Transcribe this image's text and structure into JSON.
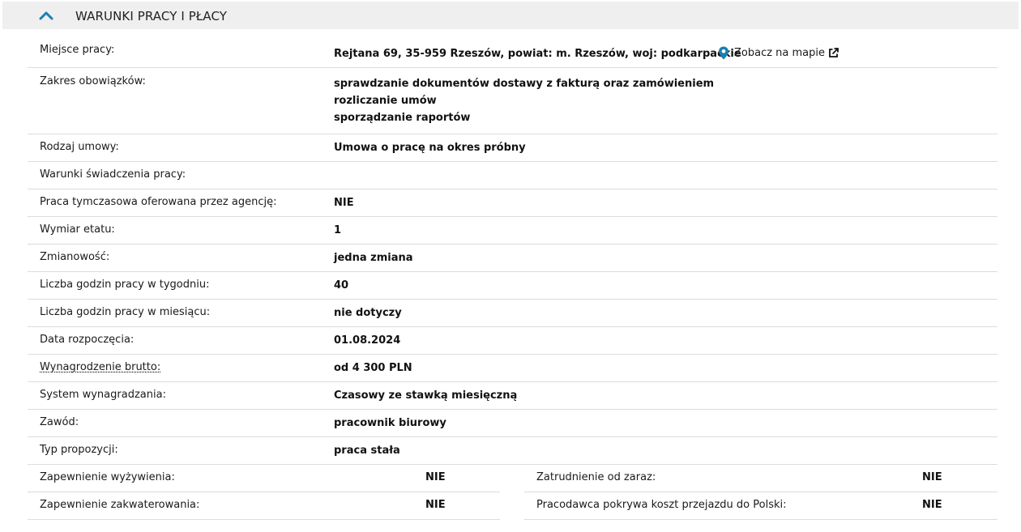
{
  "section": {
    "title": "WARUNKI PRACY I PŁACY",
    "accent_color": "#1a7fb5"
  },
  "location": {
    "label": "Miejsce pracy:",
    "value": "Rejtana 69, 35-959 Rzeszów, powiat: m. Rzeszów, woj: podkarpackie",
    "map_link": "Zobacz na mapie",
    "map_icon": "map-pin-icon",
    "external_icon": "external-link-icon"
  },
  "duties": {
    "label": "Zakres obowiązków:",
    "items": [
      "sprawdzanie dokumentów dostawy z fakturą oraz zamówieniem",
      "rozliczanie umów",
      "sporządzanie raportów"
    ]
  },
  "rows": [
    {
      "label": "Rodzaj umowy:",
      "value": "Umowa o pracę na okres próbny"
    },
    {
      "label": "Warunki świadczenia pracy:",
      "value": ""
    },
    {
      "label": "Praca tymczasowa oferowana przez agencję:",
      "value": "NIE"
    },
    {
      "label": "Wymiar etatu:",
      "value": "1"
    },
    {
      "label": "Zmianowość:",
      "value": "jedna zmiana"
    },
    {
      "label": "Liczba godzin pracy w tygodniu:",
      "value": "40"
    },
    {
      "label": "Liczba godzin pracy w miesiącu:",
      "value": "nie dotyczy"
    },
    {
      "label": "Data rozpoczęcia:",
      "value": "01.08.2024"
    },
    {
      "label": "Wynagrodzenie brutto:",
      "value": "od 4 300 PLN"
    },
    {
      "label": "System wynagradzania:",
      "value": "Czasowy ze stawką miesięczną"
    },
    {
      "label": "Zawód:",
      "value": "pracownik biurowy"
    },
    {
      "label": "Typ propozycji:",
      "value": "praca stała"
    }
  ],
  "pairs": [
    {
      "left": {
        "label": "Zapewnienie wyżywienia:",
        "value": "NIE"
      },
      "right": {
        "label": "Zatrudnienie od zaraz:",
        "value": "NIE"
      }
    },
    {
      "left": {
        "label": "Zapewnienie zakwaterowania:",
        "value": "NIE"
      },
      "right": {
        "label": "Pracodawca pokrywa koszt przejazdu do Polski:",
        "value": "NIE"
      }
    }
  ]
}
